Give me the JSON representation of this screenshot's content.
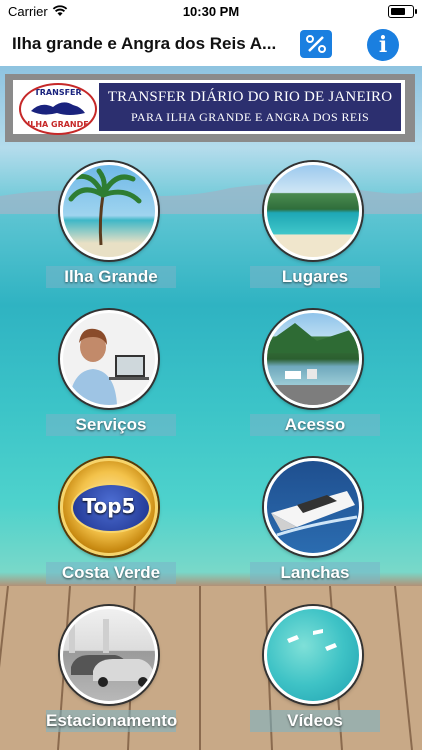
{
  "status_bar": {
    "carrier": "Carrier",
    "time": "10:30 PM"
  },
  "nav": {
    "title": "Ilha grande e Angra dos Reis A...",
    "left_icon": "percent-icon",
    "right_icon": "info-icon",
    "accent": "#1a7fe0"
  },
  "banner": {
    "logo_top": "TRANSFER",
    "logo_bottom": "ILHA GRANDE",
    "line1": "TRANSFER DIÁRIO DO RIO DE JANEIRO",
    "line2": "PARA ILHA GRANDE E ANGRA DOS REIS"
  },
  "tiles": [
    {
      "label": "Ilha Grande",
      "image": "palm-beach"
    },
    {
      "label": "Lugares",
      "image": "coastline"
    },
    {
      "label": "Serviços",
      "image": "operator"
    },
    {
      "label": "Acesso",
      "image": "harbor"
    },
    {
      "label": "Costa Verde",
      "image": "top5-badge",
      "badge": "Top5"
    },
    {
      "label": "Lanchas",
      "image": "yacht"
    },
    {
      "label": "Estacionamento",
      "image": "parking"
    },
    {
      "label": "Vídeos",
      "image": "aerial-sea"
    }
  ]
}
